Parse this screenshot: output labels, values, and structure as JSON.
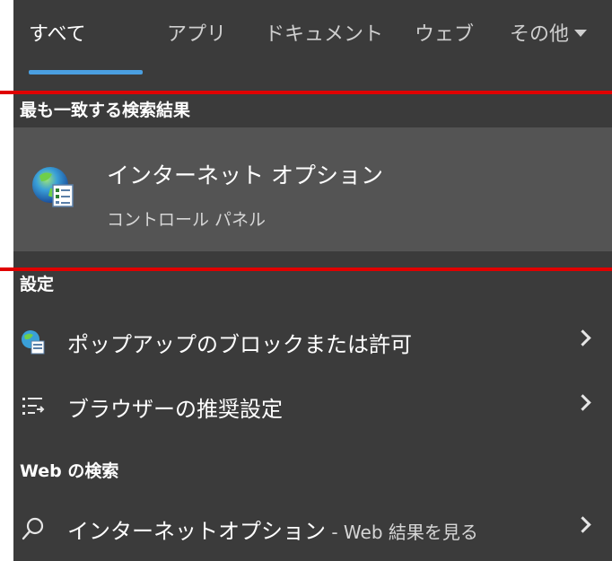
{
  "tabs": [
    {
      "label": "すべて",
      "active": true
    },
    {
      "label": "アプリ"
    },
    {
      "label": "ドキュメント"
    },
    {
      "label": "ウェブ"
    },
    {
      "label": "その他"
    }
  ],
  "best_match": {
    "heading": "最も一致する検索結果",
    "title": "インターネット オプション",
    "subtitle": "コントロール パネル",
    "icon": "internet-options-icon"
  },
  "settings": {
    "heading": "設定",
    "items": [
      {
        "label": "ポップアップのブロックまたは許可",
        "icon": "globe-settings-icon"
      },
      {
        "label": "ブラウザーの推奨設定",
        "icon": "list-settings-icon"
      }
    ]
  },
  "web_search": {
    "heading": "Web の検索",
    "query": "インターネットオプション",
    "suffix": " - Web 結果を見る",
    "icon": "search-icon"
  },
  "colors": {
    "panel": "#3b3b3b",
    "selected": "#545454",
    "accent": "#4a9fe0",
    "highlight": "#e00000"
  }
}
